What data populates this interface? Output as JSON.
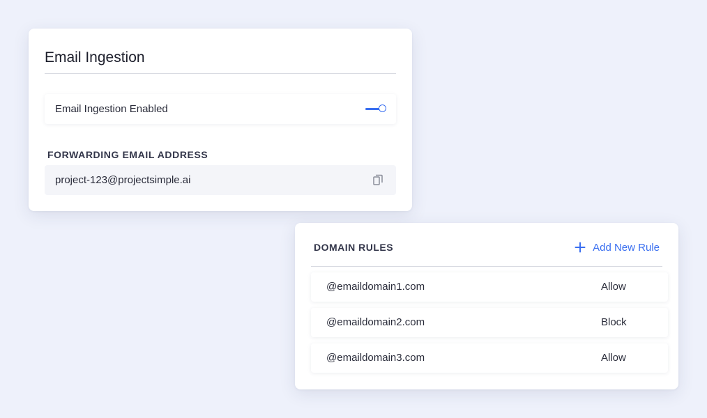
{
  "ingestion": {
    "title": "Email Ingestion",
    "toggle_label": "Email Ingestion Enabled",
    "toggle_on": true,
    "forwarding_label": "FORWARDING EMAIL ADDRESS",
    "forwarding_email": "project-123@projectsimple.ai",
    "copy_icon": "copy-icon"
  },
  "domain_rules": {
    "heading": "DOMAIN RULES",
    "add_label": "Add New Rule",
    "add_icon": "plus-icon",
    "rules": [
      {
        "domain": "@emaildomain1.com",
        "action": "Allow"
      },
      {
        "domain": "@emaildomain2.com",
        "action": "Block"
      },
      {
        "domain": "@emaildomain3.com",
        "action": "Allow"
      }
    ]
  },
  "colors": {
    "accent": "#3a6ff0",
    "background": "#eef1fb"
  }
}
